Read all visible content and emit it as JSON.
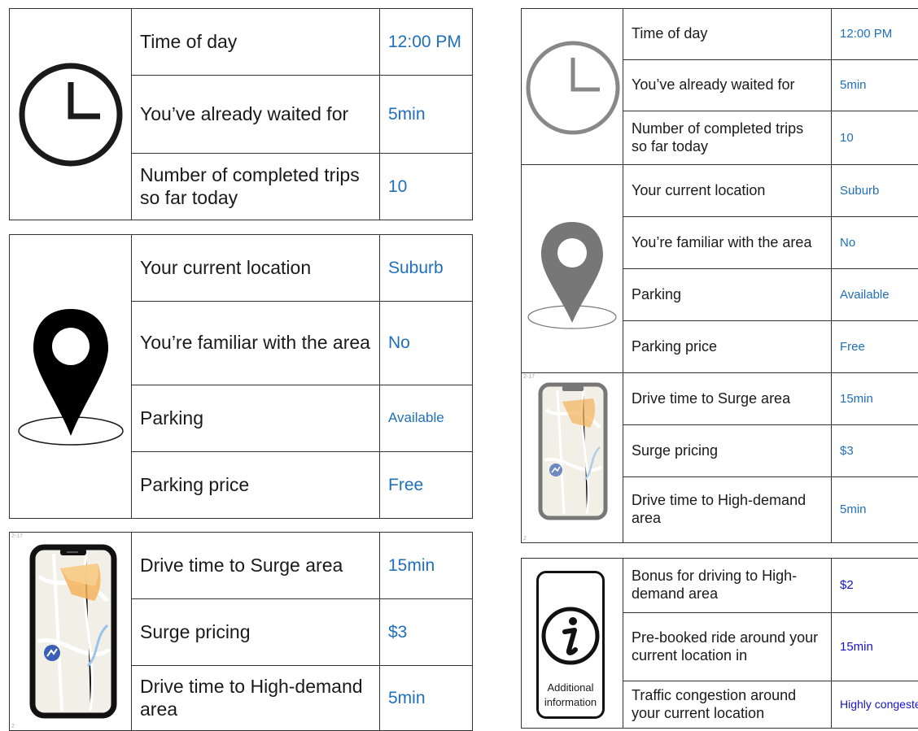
{
  "left": {
    "card1": {
      "icon": "clock-icon",
      "rows": [
        {
          "label": "Time of day",
          "value": "12:00 PM"
        },
        {
          "label": "You’ve already waited for",
          "value": "5min"
        },
        {
          "label": "Number of completed trips so far today",
          "value": "10"
        }
      ]
    },
    "card2": {
      "icon": "location-pin-icon",
      "rows": [
        {
          "label": "Your current location",
          "value": "Suburb"
        },
        {
          "label": "You’re familiar with the area",
          "value": "No"
        },
        {
          "label": "Parking",
          "value": "Available"
        },
        {
          "label": "Parking price",
          "value": "Free"
        }
      ]
    },
    "card3": {
      "icon": "phone-map-icon",
      "tag_top": "2-17",
      "tag_bottom": "2",
      "rows": [
        {
          "label": "Drive time to Surge area",
          "value": "15min"
        },
        {
          "label": "Surge pricing",
          "value": "$3"
        },
        {
          "label": "Drive time to High-demand area",
          "value": "5min"
        }
      ]
    }
  },
  "right": {
    "card1": {
      "icons": [
        "clock-icon",
        "location-pin-icon",
        "phone-map-icon"
      ],
      "tag_top": "2-17",
      "tag_bottom": "2",
      "rows": [
        {
          "label": "Time of day",
          "value": "12:00 PM"
        },
        {
          "label": "You’ve already waited for",
          "value": "5min"
        },
        {
          "label": "Number of completed trips so far today",
          "value": "10"
        },
        {
          "label": "Your current location",
          "value": "Suburb"
        },
        {
          "label": "You’re familiar with the area",
          "value": "No"
        },
        {
          "label": "Parking",
          "value": "Available"
        },
        {
          "label": "Parking price",
          "value": "Free"
        },
        {
          "label": "Drive time to Surge area",
          "value": "15min"
        },
        {
          "label": "Surge pricing",
          "value": "$3"
        },
        {
          "label": "Drive time to High-demand area",
          "value": "5min"
        }
      ]
    },
    "card2": {
      "icon": "info-icon",
      "caption": "Additional information",
      "rows": [
        {
          "label": "Bonus for driving to High-demand area",
          "value": "$2"
        },
        {
          "label": "Pre-booked ride around your current location in",
          "value": "15min"
        },
        {
          "label": "Traffic congestion around your current location",
          "value": "Highly congested"
        }
      ]
    }
  },
  "colors": {
    "value_blue": "#1f6fba",
    "value_dark_blue": "#1414c8",
    "border": "#333333"
  }
}
